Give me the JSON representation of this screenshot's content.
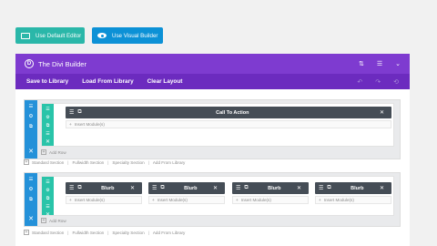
{
  "top_buttons": {
    "default_editor": "Use Default Editor",
    "visual_builder": "Use Visual Builder"
  },
  "header": {
    "logo_letter": "D",
    "title": "The Divi Builder",
    "sort_icon": "⇅",
    "menu_icon": "☰",
    "collapse_icon": "⌄"
  },
  "toolbar": {
    "save": "Save to Library",
    "load": "Load From Library",
    "clear": "Clear Layout",
    "undo_icon": "↶",
    "redo_icon": "↷",
    "history_icon": "⟲"
  },
  "icons": {
    "menu": "☰",
    "copy": "⧉",
    "gear": "⚙",
    "delete": "✕",
    "plus": "+"
  },
  "section1": {
    "module_title": "Call To Action",
    "insert": "Insert Module(s)",
    "add_row": "Add Row"
  },
  "section2": {
    "modules": [
      {
        "title": "Blurb",
        "insert": "Insert Module(s)"
      },
      {
        "title": "Blurb",
        "insert": "Insert Module(s)"
      },
      {
        "title": "Blurb",
        "insert": "Insert Module(s)"
      },
      {
        "title": "Blurb",
        "insert": "Insert Module(s)"
      }
    ],
    "add_row": "Add Row"
  },
  "section_links": {
    "standard": "Standard Section",
    "fullwidth": "Fullwidth Section",
    "specialty": "Specialty Section",
    "library": "Add From Library",
    "separator": "|"
  }
}
